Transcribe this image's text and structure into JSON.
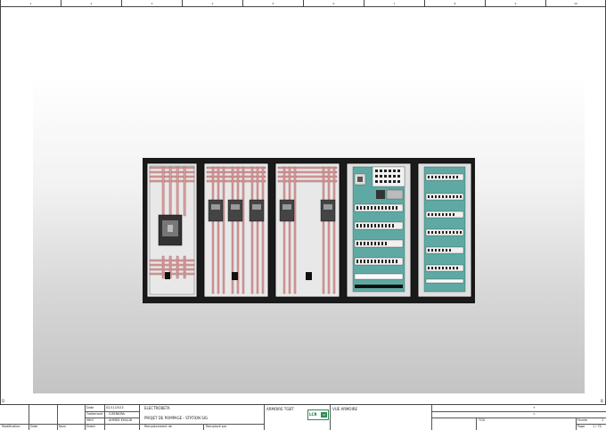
{
  "ruler": {
    "columns": [
      "1",
      "2",
      "3",
      "4",
      "5",
      "6",
      "7",
      "8",
      "9",
      "10"
    ]
  },
  "row_marks": {
    "left": "D",
    "right": "B"
  },
  "title_block": {
    "col_labels": {
      "modification": "Modification",
      "date": "Date",
      "nom": "Nom",
      "etabli": "Etabli"
    },
    "date_label": "Date",
    "date_value": "02/11/2023",
    "traitement_label": "Traitement",
    "traitement_value": "S.BENKIRA",
    "verif_label": "Vérif",
    "verif_value": "AHMED KHALID",
    "client": "ELECTROBETA",
    "project": "PROJET DE POMPAGE - STATION SIG",
    "remplace_par": "Remplacement de",
    "remplace": "Remplacé par",
    "sheet_code": "ARMOIRE TGBT",
    "logo_left": "LCR",
    "logo_right": "M",
    "view_name": "VUE ARMOIRE",
    "field_r1": "+",
    "field_r2": "=",
    "field_r3": "TGG",
    "folio_label": "Feuille",
    "folio_value": "1",
    "page_label": "Page",
    "page_value": "1 / 70"
  }
}
